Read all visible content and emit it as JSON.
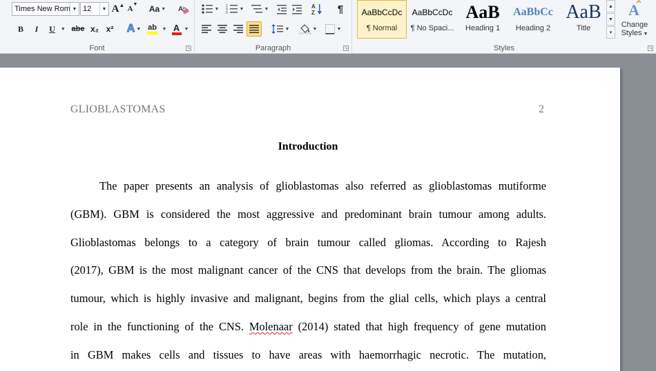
{
  "ribbon": {
    "font_group": {
      "label": "Font",
      "font_name": "Times New Rom",
      "font_size": "12",
      "grow_label": "A",
      "shrink_label": "A",
      "case_label": "Aa",
      "bold_label": "B",
      "italic_label": "I",
      "underline_label": "U",
      "strike_label": "abe",
      "subscript_label": "x₂",
      "superscript_label": "x²",
      "text_effects_label": "A",
      "highlight_label": "ab",
      "font_color_label": "A",
      "font_color": "#e02020",
      "highlight_color": "#ffff00"
    },
    "paragraph_group": {
      "label": "Paragraph",
      "show_marks_label": "¶",
      "sort_label": "A↓Z"
    },
    "styles_group": {
      "label": "Styles",
      "styles": [
        {
          "sample": "AaBbCcDc",
          "name": "¶ Normal"
        },
        {
          "sample": "AaBbCcDc",
          "name": "¶ No Spaci..."
        },
        {
          "sample": "AaB",
          "name": "Heading 1"
        },
        {
          "sample": "AaBbCc",
          "name": "Heading 2"
        },
        {
          "sample": "AaB",
          "name": "Title"
        }
      ],
      "change_styles_label": "Change",
      "change_styles_label2": "Styles"
    }
  },
  "document": {
    "header_left": "GLIOBLASTOMAS",
    "page_number": "2",
    "heading": "Introduction",
    "lines": [
      "The paper presents an analysis of glioblastomas also referred as glioblastomas mutiforme",
      "(GBM). GBM is considered the most aggressive and predominant brain tumour among adults.",
      "Glioblastomas belongs to a category of brain tumour called gliomas. According to Rajesh",
      "(2017), GBM is the most malignant cancer of the CNS that develops from the brain. The gliomas",
      "tumour, which is highly invasive and malignant, begins from the glial cells, which plays a central",
      "role in the functioning of the CNS.",
      "in GBM makes cells and tissues to have areas with haemorrhagic necrotic. The mutation,"
    ],
    "line6_spell": "Molenaar",
    "line6_rest": " (2014) stated that high frequency of gene mutation"
  }
}
